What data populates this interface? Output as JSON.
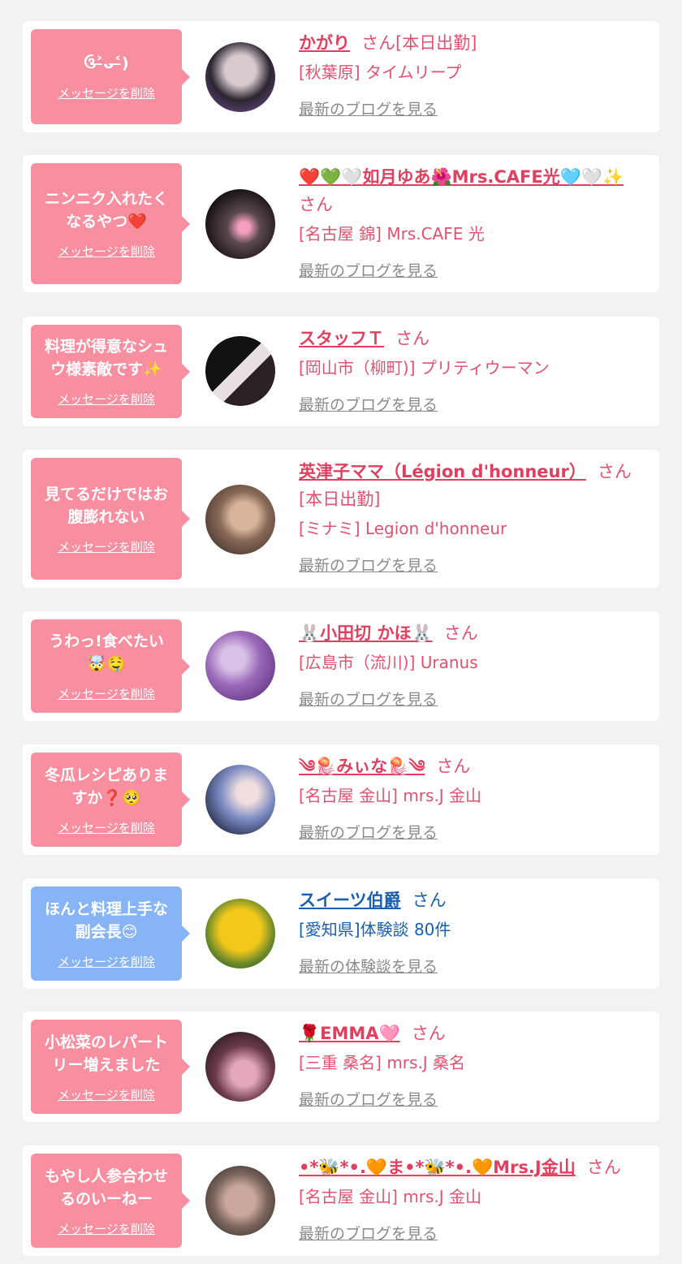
{
  "items": [
    {
      "bubble_msg": "ઉ˃̶ᴗ˂̶)",
      "delete_label": "メッセージを削除",
      "name": "かがり",
      "suffix": "さん[本日出勤]",
      "shop": "[秋葉原] タイムリープ",
      "link": "最新のブログを見る",
      "avatar_colors": [
        "#2b2630",
        "#d8c9cf"
      ]
    },
    {
      "bubble_msg": "ニンニク入れたく\nなるやつ❤️",
      "delete_label": "メッセージを削除",
      "name": "❤️💚🤍如月ゆあ🌺Mrs.CAFE光🩵🤍✨",
      "suffix": "さん",
      "shop": "[名古屋 錦] Mrs.CAFE 光",
      "link": "最新のブログを見る",
      "avatar_colors": [
        "#1c1416",
        "#5b4a50"
      ]
    },
    {
      "bubble_msg": "料理が得意なシュ\nウ様素敵です✨",
      "delete_label": "メッセージを削除",
      "name": "スタッフＴ",
      "suffix": "さん",
      "shop": "[岡山市（柳町)] プリティウーマン",
      "link": "最新のブログを見る",
      "avatar_colors": [
        "#111111",
        "#e7dfe3"
      ]
    },
    {
      "bubble_msg": "見てるだけではお\n腹膨れない",
      "delete_label": "メッセージを削除",
      "name": "英津子ママ（Légion d'honneur）",
      "suffix": "さん[本日出勤]",
      "shop": "[ミナミ] Legion d'honneur",
      "link": "最新のブログを見る",
      "avatar_colors": [
        "#4a3b33",
        "#d8b49c"
      ]
    },
    {
      "bubble_msg": "うわっ!食べたい\n🤯🤤",
      "delete_label": "メッセージを削除",
      "name": "🐰小田切 かほ🐰",
      "suffix": "さん",
      "shop": "[広島市（流川)] Uranus",
      "link": "最新のブログを見る",
      "avatar_colors": [
        "#6a3c8a",
        "#d8c1e6"
      ]
    },
    {
      "bubble_msg": "冬瓜レシピありま\nすか❓🥺",
      "delete_label": "メッセージを削除",
      "name": "༄🪼みぃな🪼༄",
      "suffix": "さん",
      "shop": "[名古屋 金山] mrs.J 金山",
      "link": "最新のブログを見る",
      "avatar_colors": [
        "#1d2540",
        "#7d8cc4"
      ]
    },
    {
      "bubble_msg": "ほんと料理上手な\n副会長😊",
      "delete_label": "メッセージを削除",
      "name": "スイーツ伯爵",
      "suffix": "さん",
      "shop": "[愛知県]体験談 80件",
      "link": "最新の体験談を見る",
      "avatar_colors": [
        "#1f3a18",
        "#f2c81b"
      ],
      "blue": true
    },
    {
      "bubble_msg": "小松菜のレパート\nリー増えました",
      "delete_label": "メッセージを削除",
      "name": "🌹EMMA🩷",
      "suffix": "さん",
      "shop": "[三重 桑名] mrs.J 桑名",
      "link": "最新のブログを見る",
      "avatar_colors": [
        "#2c1a20",
        "#e3a6bd"
      ]
    },
    {
      "bubble_msg": "もやし人参合わせ\nるのいーねー",
      "delete_label": "メッセージを削除",
      "name": "•*🐝*•.🧡ま•*🐝*•.🧡Mrs.J金山",
      "suffix": "さん",
      "shop": "[名古屋 金山] mrs.J 金山",
      "link": "最新のブログを見る",
      "avatar_colors": [
        "#3a3230",
        "#caa79a"
      ]
    }
  ]
}
